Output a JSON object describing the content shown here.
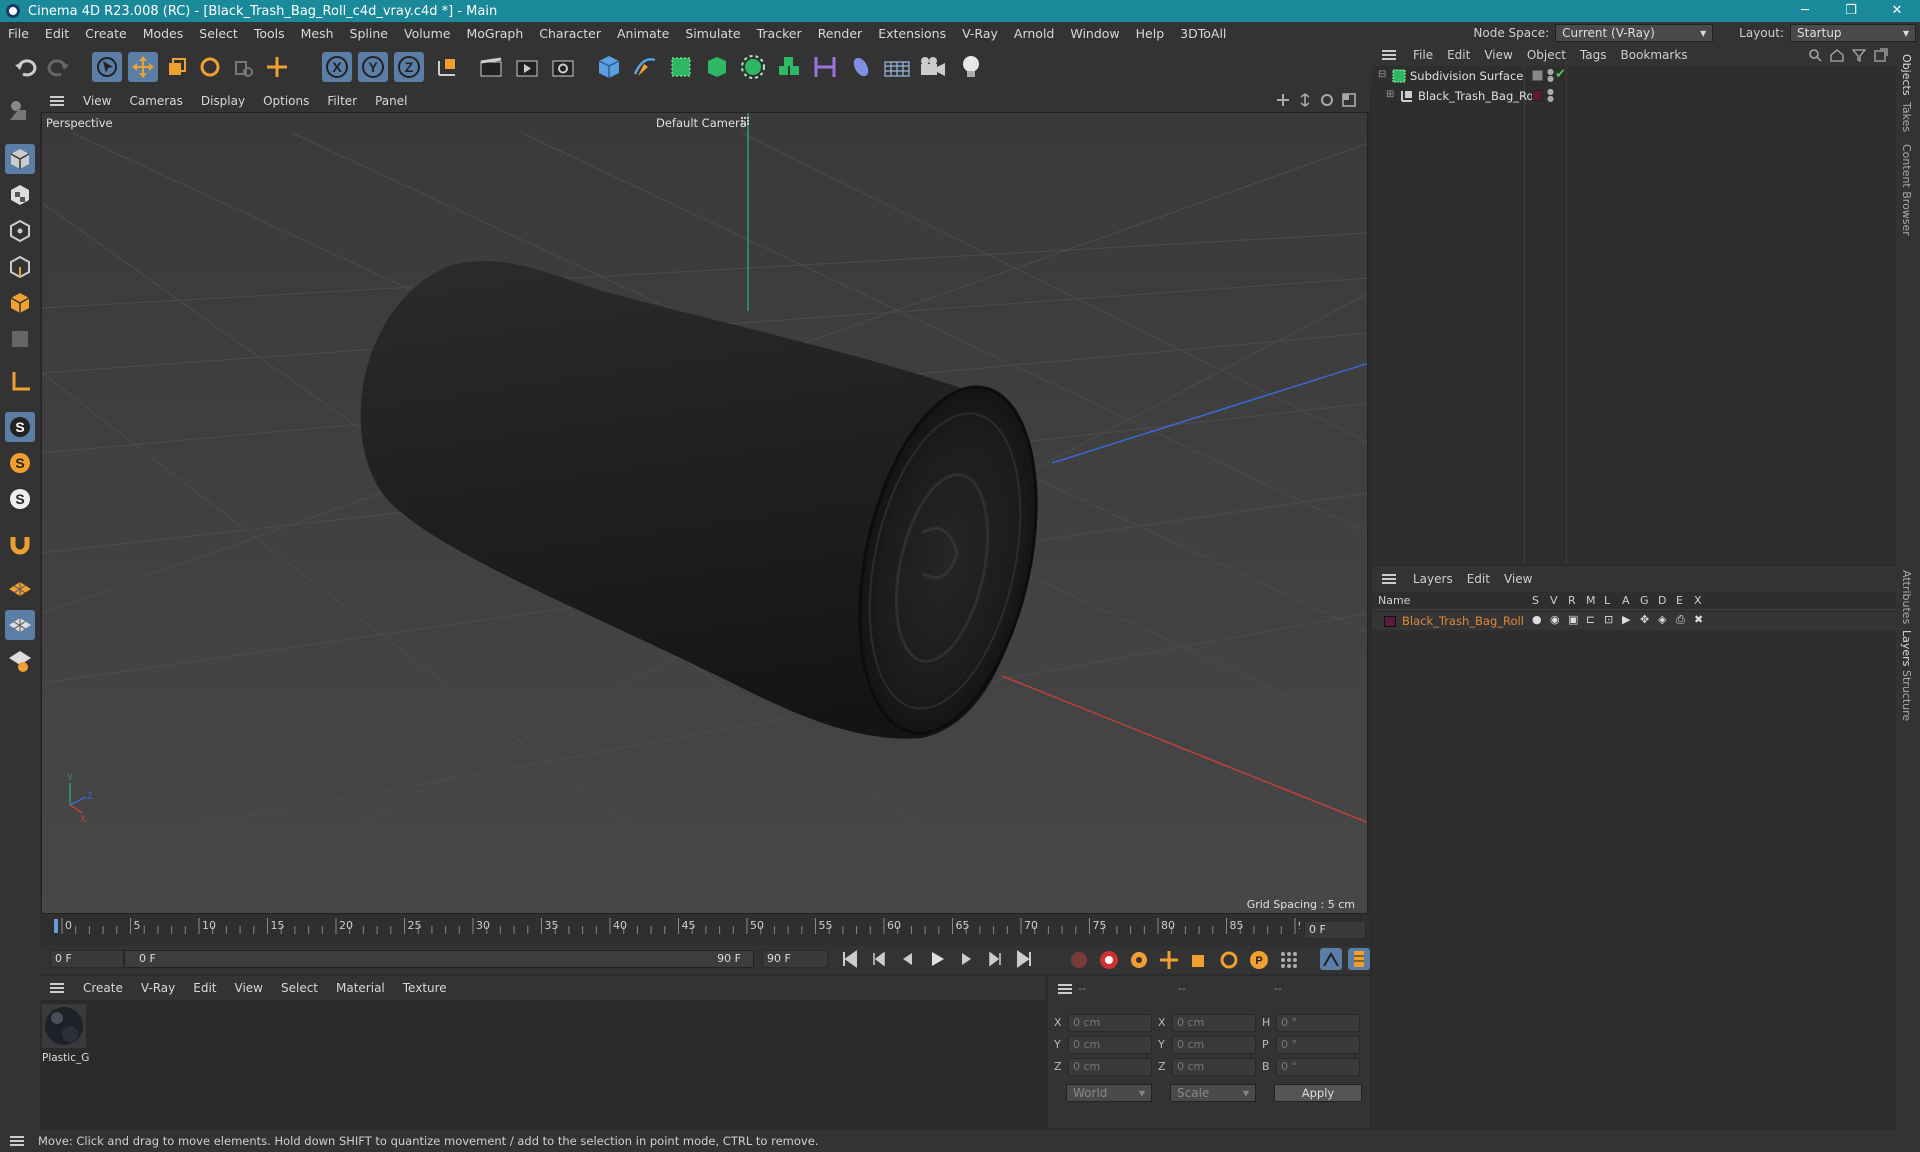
{
  "window": {
    "title": "Cinema 4D R23.008 (RC) - [Black_Trash_Bag_Roll_c4d_vray.c4d *] - Main",
    "controls": [
      "─",
      "❐",
      "✕"
    ]
  },
  "menubar": {
    "items": [
      "File",
      "Edit",
      "Create",
      "Modes",
      "Select",
      "Tools",
      "Mesh",
      "Spline",
      "Volume",
      "MoGraph",
      "Character",
      "Animate",
      "Simulate",
      "Tracker",
      "Render",
      "Extensions",
      "V-Ray",
      "Arnold",
      "Window",
      "Help",
      "3DToAll"
    ],
    "node_space_label": "Node Space:",
    "node_space_value": "Current (V-Ray)",
    "layout_label": "Layout:",
    "layout_value": "Startup"
  },
  "viewport_menu": {
    "items": [
      "View",
      "Cameras",
      "Display",
      "Options",
      "Filter",
      "Panel"
    ]
  },
  "viewport": {
    "view_name": "Perspective",
    "camera_label": "Default Camera",
    "grid_spacing": "Grid Spacing : 5 cm"
  },
  "timeline": {
    "ticks": [
      "0",
      "5",
      "10",
      "15",
      "20",
      "25",
      "30",
      "35",
      "40",
      "45",
      "50",
      "55",
      "60",
      "65",
      "70",
      "75",
      "80",
      "85",
      "90"
    ],
    "current_frame": "0 F"
  },
  "playbar": {
    "start_field": "0 F",
    "range_start": "0 F",
    "range_end": "90 F",
    "end_field": "90 F"
  },
  "material_menu": {
    "items": [
      "Create",
      "V-Ray",
      "Edit",
      "View",
      "Select",
      "Material",
      "Texture"
    ]
  },
  "materials": [
    {
      "name": "Plastic_G"
    }
  ],
  "coordinates": {
    "header": [
      "--",
      "--",
      "--"
    ],
    "rows": [
      {
        "l1": "X",
        "v1": "0 cm",
        "l2": "X",
        "v2": "0 cm",
        "l3": "H",
        "v3": "0 °"
      },
      {
        "l1": "Y",
        "v1": "0 cm",
        "l2": "Y",
        "v2": "0 cm",
        "l3": "P",
        "v3": "0 °"
      },
      {
        "l1": "Z",
        "v1": "0 cm",
        "l2": "Z",
        "v2": "0 cm",
        "l3": "B",
        "v3": "0 °"
      }
    ],
    "world_select": "World",
    "scale_select": "Scale",
    "apply_label": "Apply"
  },
  "object_manager": {
    "menu": [
      "File",
      "Edit",
      "View",
      "Object",
      "Tags",
      "Bookmarks"
    ],
    "objects": [
      {
        "name": "Subdivision Surface"
      },
      {
        "name": "Black_Trash_Bag_Roll"
      }
    ]
  },
  "layer_manager": {
    "menu": [
      "Layers",
      "Edit",
      "View"
    ],
    "name_header": "Name",
    "column_flags": [
      "S",
      "V",
      "R",
      "M",
      "L",
      "A",
      "G",
      "D",
      "E",
      "X"
    ],
    "layers": [
      {
        "name": "Black_Trash_Bag_Roll",
        "color": "#5a1a3a"
      }
    ]
  },
  "right_tabs": [
    "Objects",
    "Takes",
    "Content Browser",
    "Attributes",
    "Layers",
    "Structure"
  ],
  "status": {
    "text": "Move: Click and drag to move elements. Hold down SHIFT to quantize movement / add to the selection in point mode, CTRL to remove."
  },
  "colors": {
    "accent": "#5a7ea6",
    "title_bar": "#1a8a9a",
    "layer_name": "#e0883a"
  }
}
